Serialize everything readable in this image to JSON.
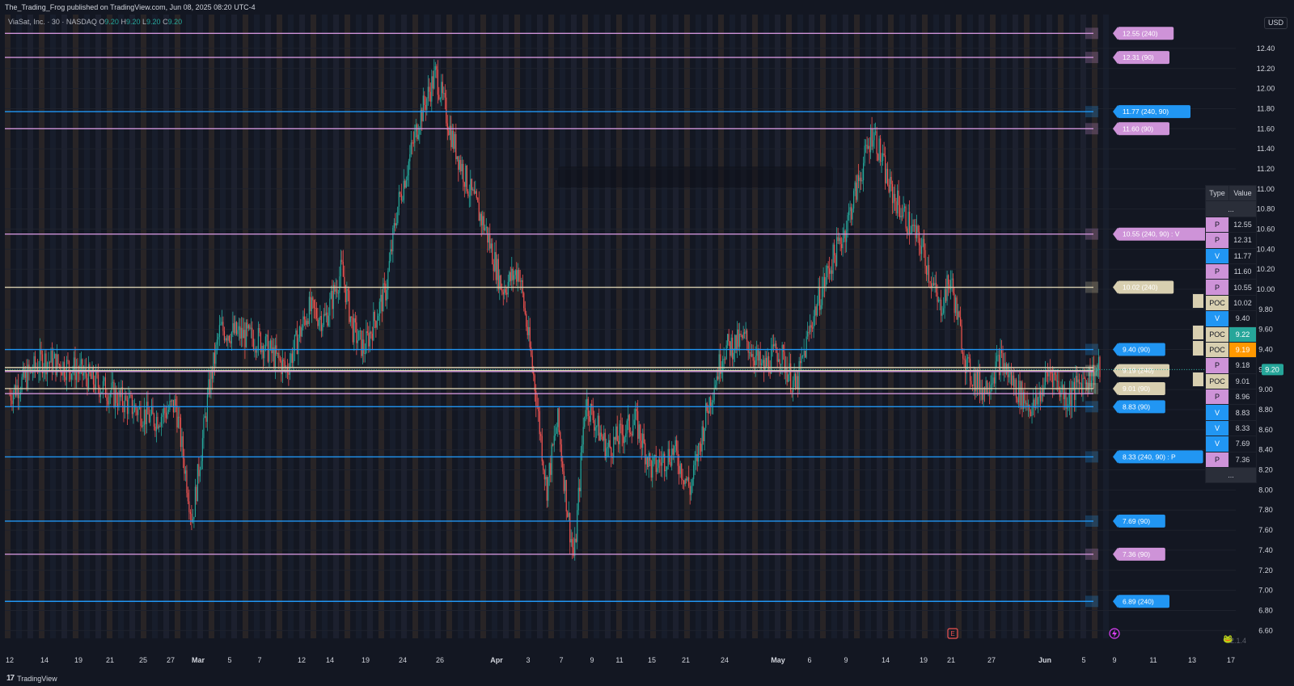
{
  "header": {
    "published": "The_Trading_Frog published on TradingView.com, Jun 08, 2025 08:20 UTC-4"
  },
  "legend": {
    "symbol": "ViaSat, Inc. · 30 · NASDAQ",
    "o_label": "O",
    "o_value": "9.20",
    "h_label": "H",
    "h_value": "9.20",
    "l_label": "L",
    "l_value": "9.20",
    "c_label": "C",
    "c_value": "9.20"
  },
  "currency": "USD",
  "footer": {
    "brand": "TradingView",
    "version": "2.1.4"
  },
  "colors": {
    "bg": "#131722",
    "grid": "#1e222d",
    "up": "#26a69a",
    "down": "#ef5350",
    "purple": "#ce93d8",
    "blue": "#2196f3",
    "beige": "#d8cfb0",
    "teal": "#26a69a",
    "orange": "#ff9800"
  },
  "level_table": {
    "headers": [
      "Type",
      "Value"
    ],
    "ellipsis": "...",
    "rows": [
      {
        "type": "P",
        "value": "12.55",
        "color": "purple",
        "value_bg": ""
      },
      {
        "type": "P",
        "value": "12.31",
        "color": "purple",
        "value_bg": ""
      },
      {
        "type": "V",
        "value": "11.77",
        "color": "blue",
        "value_bg": ""
      },
      {
        "type": "P",
        "value": "11.60",
        "color": "purple",
        "value_bg": ""
      },
      {
        "type": "P",
        "value": "10.55",
        "color": "purple",
        "value_bg": ""
      },
      {
        "type": "POC",
        "value": "10.02",
        "color": "beige",
        "value_bg": ""
      },
      {
        "type": "V",
        "value": "9.40",
        "color": "blue",
        "value_bg": ""
      },
      {
        "type": "POC",
        "value": "9.22",
        "color": "beige",
        "value_bg": "teal"
      },
      {
        "type": "POC",
        "value": "9.19",
        "color": "beige",
        "value_bg": "orange"
      },
      {
        "type": "P",
        "value": "9.18",
        "color": "purple",
        "value_bg": ""
      },
      {
        "type": "POC",
        "value": "9.01",
        "color": "beige",
        "value_bg": ""
      },
      {
        "type": "P",
        "value": "8.96",
        "color": "purple",
        "value_bg": ""
      },
      {
        "type": "V",
        "value": "8.83",
        "color": "blue",
        "value_bg": ""
      },
      {
        "type": "V",
        "value": "8.33",
        "color": "blue",
        "value_bg": ""
      },
      {
        "type": "V",
        "value": "7.69",
        "color": "blue",
        "value_bg": ""
      },
      {
        "type": "P",
        "value": "7.36",
        "color": "purple",
        "value_bg": ""
      }
    ]
  },
  "chart_data": {
    "type": "candlestick",
    "title": "ViaSat, Inc. · 30 · NASDAQ",
    "xlabel": "",
    "ylabel": "",
    "ylim": [
      6.5,
      12.6
    ],
    "last_price": "9.20",
    "y_ticks": [
      "12.40",
      "12.20",
      "12.00",
      "11.80",
      "11.60",
      "11.40",
      "11.20",
      "11.00",
      "10.80",
      "10.60",
      "10.40",
      "10.20",
      "10.00",
      "9.80",
      "9.60",
      "9.40",
      "9.20",
      "9.00",
      "8.80",
      "8.60",
      "8.40",
      "8.20",
      "8.00",
      "7.80",
      "7.60",
      "7.40",
      "7.20",
      "7.00",
      "6.80",
      "6.60"
    ],
    "x_ticks": [
      "12",
      "14",
      "19",
      "21",
      "25",
      "27",
      "Mar",
      "5",
      "7",
      "12",
      "14",
      "19",
      "24",
      "26",
      "Apr",
      "3",
      "7",
      "9",
      "11",
      "15",
      "21",
      "24",
      "May",
      "6",
      "9",
      "14",
      "19",
      "21",
      "27",
      "Jun",
      "5",
      "9",
      "11",
      "13",
      "17"
    ],
    "price_path": [
      [
        0,
        8.95
      ],
      [
        6,
        9.3
      ],
      [
        12,
        9.2
      ],
      [
        20,
        8.9
      ],
      [
        26,
        8.7
      ],
      [
        30,
        8.85
      ],
      [
        33,
        7.7
      ],
      [
        36,
        9.0
      ],
      [
        38,
        9.6
      ],
      [
        45,
        9.5
      ],
      [
        50,
        9.2
      ],
      [
        54,
        9.8
      ],
      [
        57,
        9.7
      ],
      [
        60,
        10.2
      ],
      [
        62,
        9.6
      ],
      [
        64,
        9.4
      ],
      [
        68,
        10.0
      ],
      [
        70,
        10.8
      ],
      [
        74,
        11.7
      ],
      [
        77,
        12.15
      ],
      [
        80,
        11.5
      ],
      [
        83,
        11.0
      ],
      [
        86,
        10.6
      ],
      [
        89,
        10.0
      ],
      [
        92,
        10.2
      ],
      [
        95,
        9.0
      ],
      [
        97,
        8.0
      ],
      [
        99,
        8.7
      ],
      [
        101,
        7.7
      ],
      [
        102,
        7.3
      ],
      [
        104,
        8.9
      ],
      [
        108,
        8.4
      ],
      [
        113,
        8.7
      ],
      [
        116,
        8.2
      ],
      [
        120,
        8.4
      ],
      [
        123,
        8.0
      ],
      [
        126,
        8.8
      ],
      [
        129,
        9.4
      ],
      [
        133,
        9.5
      ],
      [
        136,
        9.2
      ],
      [
        139,
        9.4
      ],
      [
        142,
        9.0
      ],
      [
        145,
        9.7
      ],
      [
        148,
        10.2
      ],
      [
        151,
        10.6
      ],
      [
        154,
        11.2
      ],
      [
        156,
        11.6
      ],
      [
        159,
        11.0
      ],
      [
        162,
        10.7
      ],
      [
        165,
        10.4
      ],
      [
        168,
        9.8
      ],
      [
        170,
        10.1
      ],
      [
        173,
        9.2
      ],
      [
        176,
        9.0
      ],
      [
        179,
        9.3
      ],
      [
        182,
        9.0
      ],
      [
        185,
        8.8
      ],
      [
        188,
        9.2
      ],
      [
        191,
        8.9
      ],
      [
        194,
        9.1
      ],
      [
        197,
        9.2
      ]
    ],
    "levels": [
      {
        "price": 12.55,
        "label": "12.55 (240)",
        "color": "purple"
      },
      {
        "price": 12.31,
        "label": "12.31 (90)",
        "color": "purple"
      },
      {
        "price": 11.77,
        "label": "11.77 (240, 90)",
        "color": "blue"
      },
      {
        "price": 11.6,
        "label": "11.60 (90)",
        "color": "purple"
      },
      {
        "price": 10.55,
        "label": "10.55 (240, 90) : V",
        "color": "purple"
      },
      {
        "price": 10.02,
        "label": "10.02 (240)",
        "color": "beige"
      },
      {
        "price": 9.4,
        "label": "9.40 (90)",
        "color": "blue"
      },
      {
        "price": 9.22,
        "label": "",
        "color": "beige"
      },
      {
        "price": 9.19,
        "label": "9.19 (240)",
        "color": "beige"
      },
      {
        "price": 9.18,
        "label": "",
        "color": "purple"
      },
      {
        "price": 9.01,
        "label": "9.01 (90)",
        "color": "beige"
      },
      {
        "price": 8.96,
        "label": "",
        "color": "purple"
      },
      {
        "price": 8.83,
        "label": "8.83 (90)",
        "color": "blue"
      },
      {
        "price": 8.33,
        "label": "8.33 (240, 90) : P",
        "color": "blue"
      },
      {
        "price": 7.69,
        "label": "7.69 (90)",
        "color": "blue"
      },
      {
        "price": 7.36,
        "label": "7.36 (90)",
        "color": "purple"
      },
      {
        "price": 6.89,
        "label": "6.89 (240)",
        "color": "blue"
      }
    ],
    "grid": true
  },
  "icons": [
    "earnings-icon",
    "flash-icon",
    "frog-icon"
  ],
  "earnings_marker": "E"
}
